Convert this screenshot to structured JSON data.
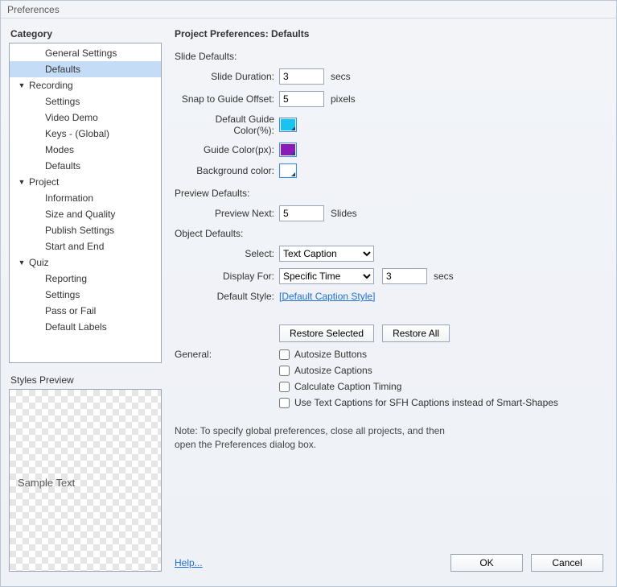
{
  "window": {
    "title": "Preferences"
  },
  "sidebar": {
    "heading": "Category",
    "items": [
      {
        "label": "General Settings",
        "level": 1,
        "children": false
      },
      {
        "label": "Defaults",
        "level": 1,
        "children": false,
        "selected": true
      },
      {
        "label": "Recording",
        "level": 0,
        "children": true
      },
      {
        "label": "Settings",
        "level": 1,
        "children": false
      },
      {
        "label": "Video Demo",
        "level": 1,
        "children": false
      },
      {
        "label": "Keys - (Global)",
        "level": 1,
        "children": false
      },
      {
        "label": "Modes",
        "level": 1,
        "children": false
      },
      {
        "label": "Defaults",
        "level": 1,
        "children": false
      },
      {
        "label": "Project",
        "level": 0,
        "children": true
      },
      {
        "label": "Information",
        "level": 1,
        "children": false
      },
      {
        "label": "Size and Quality",
        "level": 1,
        "children": false
      },
      {
        "label": "Publish Settings",
        "level": 1,
        "children": false
      },
      {
        "label": "Start and End",
        "level": 1,
        "children": false
      },
      {
        "label": "Quiz",
        "level": 0,
        "children": true
      },
      {
        "label": "Reporting",
        "level": 1,
        "children": false
      },
      {
        "label": "Settings",
        "level": 1,
        "children": false
      },
      {
        "label": "Pass or Fail",
        "level": 1,
        "children": false
      },
      {
        "label": "Default Labels",
        "level": 1,
        "children": false
      }
    ],
    "styles_preview_label": "Styles Preview",
    "sample_text": "Sample Text"
  },
  "main": {
    "heading": "Project Preferences: Defaults",
    "slide_defaults": {
      "title": "Slide Defaults:",
      "duration_label": "Slide Duration:",
      "duration_value": "3",
      "duration_unit": "secs",
      "snap_label": "Snap to Guide Offset:",
      "snap_value": "5",
      "snap_unit": "pixels",
      "guide_pct_label": "Default Guide Color(%):",
      "guide_pct_color": "#18c4ef",
      "guide_px_label": "Guide Color(px):",
      "guide_px_color": "#8a1bb8",
      "bg_label": "Background color:",
      "bg_color": "#ffffff"
    },
    "preview_defaults": {
      "title": "Preview Defaults:",
      "preview_next_label": "Preview Next:",
      "preview_next_value": "5",
      "preview_next_unit": "Slides"
    },
    "object_defaults": {
      "title": "Object Defaults:",
      "select_label": "Select:",
      "select_value": "Text Caption",
      "display_for_label": "Display For:",
      "display_for_value": "Specific Time",
      "display_for_seconds": "3",
      "display_for_unit": "secs",
      "default_style_label": "Default Style:",
      "default_style_link": "[Default Caption Style]"
    },
    "buttons": {
      "restore_selected": "Restore Selected",
      "restore_all": "Restore All"
    },
    "general": {
      "title": "General:",
      "autosize_buttons": "Autosize Buttons",
      "autosize_captions": "Autosize Captions",
      "calc_caption_timing": "Calculate Caption Timing",
      "use_text_captions": "Use Text Captions for SFH Captions instead of Smart-Shapes"
    },
    "note": "Note: To specify global preferences, close all projects, and then open the Preferences dialog box."
  },
  "footer": {
    "help": "Help...",
    "ok": "OK",
    "cancel": "Cancel"
  }
}
